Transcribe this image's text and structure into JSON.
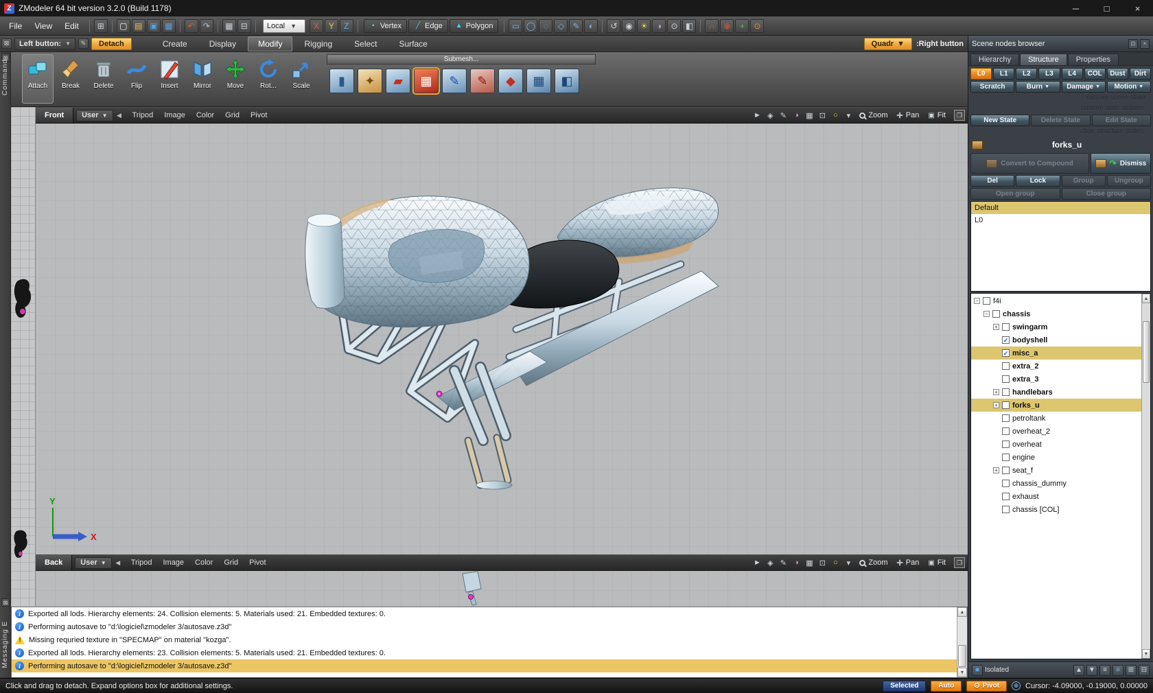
{
  "window": {
    "title": "ZModeler 64 bit version 3.2.0 (Build 1178)"
  },
  "menubar": {
    "menus": [
      "File",
      "View",
      "Edit"
    ],
    "local_label": "Local",
    "icon_groups_pre": [
      [
        "app-grid-icon"
      ],
      [
        "new-file-icon",
        "open-file-icon",
        "save-file-icon",
        "save-all-icon"
      ],
      [
        "undo-icon",
        "redo-icon"
      ],
      [
        "grid-settings-icon",
        "snap-icon"
      ]
    ],
    "filter_icons": [
      "filter-x-icon",
      "filter-y-icon",
      "filter-z-icon"
    ],
    "mode_buttons": [
      {
        "label": "Vertex",
        "icon": "vertex-icon"
      },
      {
        "label": "Edge",
        "icon": "edge-icon"
      },
      {
        "label": "Polygon",
        "icon": "polygon-icon"
      }
    ],
    "icon_groups_post": [
      [
        "select-rect-icon",
        "select-circle-icon",
        "select-lasso-icon",
        "select-poly-icon",
        "select-paint-icon",
        "select-invert-icon"
      ],
      [
        "orbit-icon",
        "eye-icon",
        "light-icon",
        "material-icon",
        "render-icon",
        "mirror-view-icon"
      ],
      [
        "magnet-icon",
        "weld-icon",
        "axis-icon",
        "pivot-mini-icon"
      ]
    ]
  },
  "ribbon": {
    "left_button_label": "Left button:",
    "detach_label": "Detach",
    "tabs": [
      "Create",
      "Display",
      "Modify",
      "Rigging",
      "Select",
      "Surface"
    ],
    "active_tab": "Modify",
    "quadr_label": "Quadr",
    "right_button_label": ":Right button"
  },
  "toolbar": {
    "tools": [
      {
        "label": "Attach",
        "icon": "attach-icon",
        "active": true
      },
      {
        "label": "Break",
        "icon": "break-icon"
      },
      {
        "label": "Delete",
        "icon": "delete-icon"
      },
      {
        "label": "Flip",
        "icon": "flip-icon"
      },
      {
        "label": "Insert",
        "icon": "insert-icon"
      },
      {
        "label": "Mirror",
        "icon": "mirror-icon"
      },
      {
        "label": "Move",
        "icon": "move-icon"
      },
      {
        "label": "Rot...",
        "icon": "rotate-icon"
      },
      {
        "label": "Scale",
        "icon": "scale-icon"
      }
    ],
    "submesh_label": "Submesh...",
    "submesh_icons": [
      {
        "name": "submesh-cylinder-icon"
      },
      {
        "name": "submesh-polish-icon"
      },
      {
        "name": "submesh-extrude-icon"
      },
      {
        "name": "submesh-detach-icon",
        "active": true
      },
      {
        "name": "submesh-edit-icon"
      },
      {
        "name": "submesh-mark-icon"
      },
      {
        "name": "submesh-split-icon"
      },
      {
        "name": "submesh-box-icon"
      },
      {
        "name": "submesh-panel-icon"
      }
    ]
  },
  "viewports": {
    "front": {
      "view_label": "Front",
      "user_label": "User",
      "menu": [
        "Tripod",
        "Image",
        "Color",
        "Grid",
        "Pivot"
      ],
      "zoom_label": "Zoom",
      "pan_label": "Pan",
      "fit_label": "Fit"
    },
    "back": {
      "view_label": "Back",
      "user_label": "User",
      "menu": [
        "Tripod",
        "Image",
        "Color",
        "Grid",
        "Pivot"
      ],
      "zoom_label": "Zoom",
      "pan_label": "Pan",
      "fit_label": "Fit"
    },
    "right_icons": [
      "select-arrow-icon",
      "hand-icon",
      "paint-icon",
      "material-icon",
      "grid-toggle-icon",
      "screenshot-icon",
      "bulb-icon",
      "dropdown-icon"
    ],
    "axis": {
      "x": "X",
      "y": "Y"
    }
  },
  "left_rail": {
    "command_label": "Command",
    "messaging_label": "Messaging E"
  },
  "scene_panel": {
    "title": "Scene nodes browser",
    "tabs": [
      {
        "label": "Hierarchy"
      },
      {
        "label": "Structure",
        "active": true
      },
      {
        "label": "Properties"
      }
    ],
    "lod_buttons": [
      {
        "label": "L0",
        "active": true
      },
      {
        "label": "L1"
      },
      {
        "label": "L2"
      },
      {
        "label": "L3"
      },
      {
        "label": "L4"
      },
      {
        "label": "COL"
      },
      {
        "label": "Dust"
      },
      {
        "label": "Dirt"
      }
    ],
    "state_buttons": [
      {
        "label": "Scratch"
      },
      {
        "label": "Burn",
        "dropdown": true
      },
      {
        "label": "Damage",
        "dropdown": true
      },
      {
        "label": "Motion",
        "dropdown": true
      }
    ],
    "custom_state_label": "custom scene state",
    "custom_actions_label": "custom state actions:",
    "state_actions": [
      {
        "label": "New State",
        "enabled": true
      },
      {
        "label": "Delete State",
        "enabled": false
      },
      {
        "label": "Edit State",
        "enabled": false
      }
    ],
    "structure_states_label": "ction structure states:",
    "selected_node_label": "forks_u",
    "convert_button": {
      "label": "Convert to Compound",
      "enabled": false
    },
    "dismiss_button": {
      "label": "Dismiss",
      "enabled": true
    },
    "edit_buttons": [
      {
        "label": "Del",
        "enabled": true
      },
      {
        "label": "Lock",
        "enabled": true
      },
      {
        "label": "Group",
        "enabled": false
      },
      {
        "label": "Ungroup",
        "enabled": false
      }
    ],
    "group_buttons": [
      {
        "label": "Open group",
        "enabled": false
      },
      {
        "label": "Close group",
        "enabled": false
      }
    ],
    "states_list": [
      {
        "label": "Default",
        "highlight": true
      },
      {
        "label": "L0"
      }
    ],
    "isolated_label": "Isolated",
    "bottom_icons": [
      "layer-up-icon",
      "layer-down-icon",
      "sort-list-icon",
      "sort-list2-icon",
      "expand-tree-icon",
      "collapse-tree-icon"
    ]
  },
  "scene_tree": {
    "nodes": [
      {
        "label": "f4i",
        "level": 0,
        "expander": "minus",
        "checked": false,
        "bold": false
      },
      {
        "label": "chassis",
        "level": 1,
        "expander": "minus",
        "checked": false,
        "bold": true
      },
      {
        "label": "swingarm",
        "level": 2,
        "expander": "plus",
        "checked": false,
        "bold": true
      },
      {
        "label": "bodyshell",
        "level": 2,
        "expander": null,
        "checked": true,
        "bold": true
      },
      {
        "label": "misc_a",
        "level": 2,
        "expander": null,
        "checked": true,
        "bold": true,
        "highlight": true
      },
      {
        "label": "extra_2",
        "level": 2,
        "expander": null,
        "checked": false,
        "bold": true
      },
      {
        "label": "extra_3",
        "level": 2,
        "expander": null,
        "checked": false,
        "bold": true
      },
      {
        "label": "handlebars",
        "level": 2,
        "expander": "plus",
        "checked": false,
        "bold": true
      },
      {
        "label": "forks_u",
        "level": 2,
        "expander": "plus",
        "checked": false,
        "bold": true,
        "highlight": true
      },
      {
        "label": "petroltank",
        "level": 2,
        "expander": null,
        "checked": false,
        "bold": false
      },
      {
        "label": "overheat_2",
        "level": 2,
        "expander": null,
        "checked": false,
        "bold": false
      },
      {
        "label": "overheat",
        "level": 2,
        "expander": null,
        "checked": false,
        "bold": false
      },
      {
        "label": "engine",
        "level": 2,
        "expander": null,
        "checked": false,
        "bold": false
      },
      {
        "label": "seat_f",
        "level": 2,
        "expander": "plus",
        "checked": false,
        "bold": false
      },
      {
        "label": "chassis_dummy",
        "level": 2,
        "expander": null,
        "checked": false,
        "bold": false
      },
      {
        "label": "exhaust",
        "level": 2,
        "expander": null,
        "checked": false,
        "bold": false
      },
      {
        "label": "chassis [COL]",
        "level": 2,
        "expander": null,
        "checked": false,
        "bold": false
      }
    ]
  },
  "log": {
    "lines": [
      {
        "type": "info",
        "text": "Exported all lods. Hierarchy elements: 24. Collision elements: 5. Materials used: 21. Embedded textures: 0."
      },
      {
        "type": "info",
        "text": "Performing autosave to \"d:\\logiciel\\zmodeler 3/autosave.z3d\""
      },
      {
        "type": "warning",
        "text": "Missing requried texture in \"SPECMAP\" on material \"kozga\"."
      },
      {
        "type": "info",
        "text": "Exported all lods. Hierarchy elements: 23. Collision elements: 5. Materials used: 21. Embedded textures: 0."
      },
      {
        "type": "info",
        "text": "Performing autosave to \"d:\\logiciel\\zmodeler 3/autosave.z3d\"",
        "highlight": true
      }
    ]
  },
  "statusbar": {
    "hint": "Click and drag to detach. Expand options box for additional settings.",
    "selected_label": "Selected",
    "auto_label": "Auto",
    "pivot_label": "Pivot",
    "cursor_label": "Cursor: -4.09000, -0.19000, 0.00000"
  }
}
